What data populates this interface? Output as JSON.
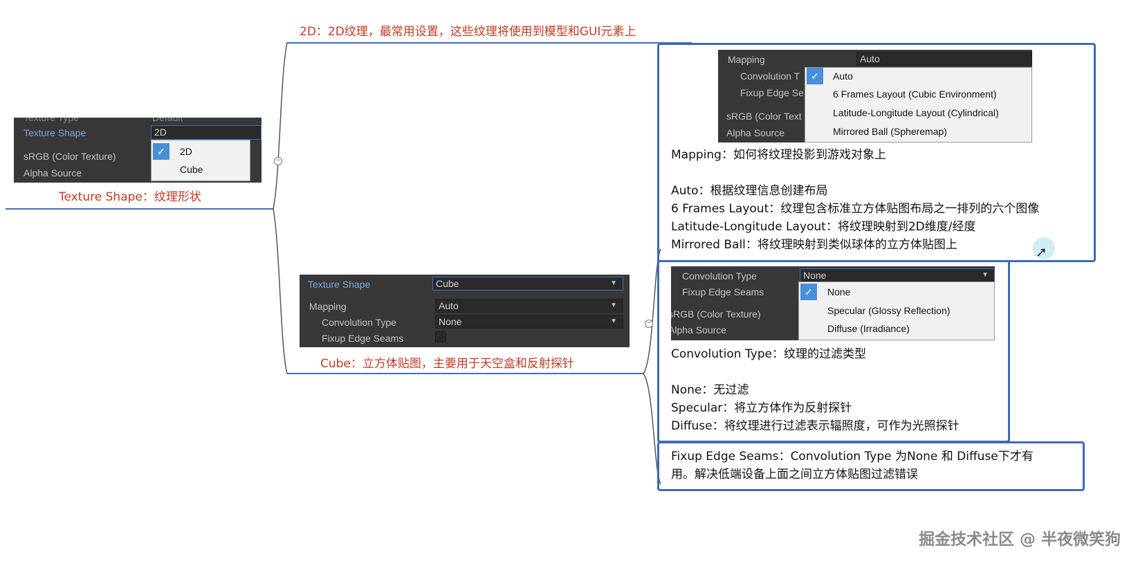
{
  "shape_panel": {
    "texture_type_label": "Texture Type",
    "texture_type_value": "Default",
    "texture_shape_label": "Texture Shape",
    "texture_shape_value": "2D",
    "srgb_label": "sRGB (Color Texture)",
    "alpha_source_label": "Alpha Source",
    "menu_items": [
      "2D",
      "Cube"
    ],
    "caption": "Texture Shape：纹理形状"
  },
  "branch_2d": {
    "caption": "2D：2D纹理，最常用设置，这些纹理将使用到模型和GUI元素上"
  },
  "cube_panel": {
    "texture_shape_label": "Texture Shape",
    "texture_shape_value": "Cube",
    "mapping_label": "Mapping",
    "mapping_value": "Auto",
    "convolution_label": "Convolution Type",
    "convolution_value": "None",
    "fixup_label": "Fixup Edge Seams",
    "caption": "Cube：立方体贴图，主要用于天空盒和反射探针"
  },
  "mapping_panel": {
    "mapping_label": "Mapping",
    "mapping_value": "Auto",
    "convolution_label": "Convolution T",
    "fixup_label": "Fixup Edge Se",
    "srgb_label": "sRGB (Color Text",
    "alpha_label": "Alpha Source",
    "menu_items": [
      "Auto",
      "6 Frames Layout (Cubic Environment)",
      "Latitude-Longitude Layout (Cylindrical)",
      "Mirrored Ball (Spheremap)"
    ]
  },
  "mapping_notes": {
    "line1": "Mapping：如何将纹理投影到游戏对象上",
    "line2": "Auto：根据纹理信息创建布局",
    "line3": "6 Frames Layout：纹理包含标准立方体贴图布局之一排列的六个图像",
    "line4": "Latitude-Longitude Layout：将纹理映射到2D维度/经度",
    "line5": "Mirrored Ball：将纹理映射到类似球体的立方体贴图上"
  },
  "convolution_panel": {
    "convolution_label": "Convolution Type",
    "convolution_value": "None",
    "fixup_label": "Fixup Edge Seams",
    "srgb_label": "sRGB (Color Texture)",
    "alpha_label": "Alpha Source",
    "menu_items": [
      "None",
      "Specular (Glossy Reflection)",
      "Diffuse (Irradiance)"
    ]
  },
  "convolution_notes": {
    "line1": "Convolution Type：纹理的过滤类型",
    "line2": "None：无过滤",
    "line3": "Specular：将立方体作为反射探针",
    "line4": "Diffuse：将纹理进行过滤表示辐照度，可作为光照探针"
  },
  "fixup_notes": {
    "line1": "Fixup Edge Seams：Convolution Type 为None 和 Diffuse下才有",
    "line2": "用。解决低端设备上面之间立方体贴图过滤错误"
  },
  "watermark": "掘金技术社区 @ 半夜微笑狗",
  "colors": {
    "caption_red": "#c23a23",
    "frame_blue": "#3d6bb8",
    "panel_bg": "#383838",
    "check_blue": "#4a90d9"
  }
}
